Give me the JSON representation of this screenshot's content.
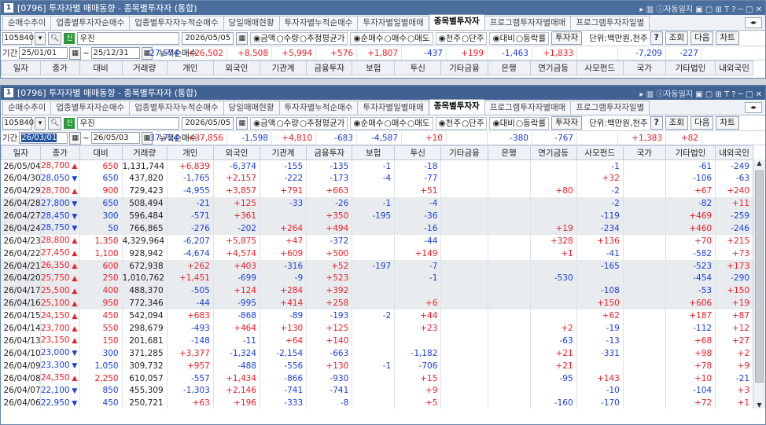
{
  "win1": {
    "title": "[0796] 투자자별 매매동향 - 종목별투자자 (통합)",
    "badge": "1",
    "tab_icons": "▸ ▥ ⓘ자동일지 ▣ ▢ ⊞ T ? ─ □ ✕",
    "tabs": [
      "순매수추이",
      "업종별투자자순매수",
      "업종별투자자누적순매수",
      "당일매매현황",
      "투자자별누적순매수",
      "투자자별일별매매",
      "종목별투자자",
      "프로그램투자자별매매",
      "프로그램투자자일별"
    ],
    "active_tab": 6,
    "code": "105840",
    "stock_badge": "신",
    "stock_name": "우진",
    "date": "2026/05/05",
    "opt_amount": "◉금액",
    "opt_qty": "○수량",
    "opt_avg": "○추정평균가",
    "opt_net": "◉순매수",
    "opt_buy": "○매수",
    "opt_sell": "○매도",
    "opt_k": "◉천주",
    "opt_dan": "○단주",
    "opt_vs": "◉대비",
    "opt_rate": "○등락률",
    "btn_investor": "투자자",
    "unit": "단위:백만원,천주",
    "btn_help": "?",
    "btn_search": "조회",
    "btn_next": "다음",
    "btn_chart": "차트",
    "period_label": "기간",
    "period_from": "25/01/01",
    "period_to": "25/12/31",
    "cum_label": "누적순매수",
    "cum_values": [
      "-27,574",
      "+26,502",
      "+8,508",
      "+5,994",
      "+576",
      "+1,807",
      "-437",
      "+199",
      "-1,463",
      "+1,833",
      "",
      "-7,209",
      "-227"
    ],
    "headers": [
      "일자",
      "종가",
      "대비",
      "거래량",
      "개인",
      "외국인",
      "기관계",
      "금융투자",
      "보험",
      "투신",
      "기타금융",
      "은행",
      "연기금등",
      "사모펀드",
      "국가",
      "기타법인",
      "내외국인"
    ]
  },
  "win2": {
    "title": "[0796] 투자자별 매매동향 - 종목별투자자 (통합)",
    "badge": "1",
    "tab_icons": "▸ ▥ ⓘ자동일지 ▣ ▢ ⊞ T ? ─ □ ✕",
    "tabs": [
      "순매수추이",
      "업종별투자자순매수",
      "업종별투자자누적순매수",
      "당일매매현황",
      "투자자별누적순매수",
      "투자자별일별매매",
      "종목별투자자",
      "프로그램투자자별매매",
      "프로그램투자자일별"
    ],
    "active_tab": 6,
    "code": "105840",
    "stock_badge": "신",
    "stock_name": "우진",
    "date": "2026/05/05",
    "opt_amount": "◉금액",
    "opt_qty": "○수량",
    "opt_avg": "○추정평균가",
    "opt_net": "◉순매수",
    "opt_buy": "○매수",
    "opt_sell": "○매도",
    "opt_k": "◉천주",
    "opt_dan": "○단주",
    "opt_vs": "◉대비",
    "opt_rate": "○등락률",
    "btn_investor": "투자자",
    "unit": "단위:백만원,천주",
    "btn_help": "?",
    "btn_search": "조회",
    "btn_next": "다음",
    "btn_chart": "차트",
    "period_label": "기간",
    "period_from": "26/03/01",
    "period_to": "26/05/03",
    "cum_label": "누적순매수",
    "cum_values": [
      "-37,724",
      "+37,856",
      "-1,598",
      "+4,810",
      "-683",
      "-4,587",
      "+10",
      "",
      "-380",
      "-767",
      "",
      "+1,383",
      "+82"
    ],
    "headers": [
      "일자",
      "종가",
      "대비",
      "거래량",
      "개인",
      "외국인",
      "기관계",
      "금융투자",
      "보험",
      "투신",
      "기타금융",
      "은행",
      "연기금등",
      "사모펀드",
      "국가",
      "기타법인",
      "내외국인"
    ],
    "rows": [
      [
        "26/05/04",
        "28,700",
        "▲",
        "650",
        "1,131,744",
        "+6,839",
        "-6,374",
        "-155",
        "-135",
        "-1",
        "-18",
        "",
        "",
        "",
        "-1",
        "",
        "-61",
        "-249"
      ],
      [
        "26/04/30",
        "28,050",
        "▼",
        "650",
        "437,820",
        "-1,765",
        "+2,157",
        "-222",
        "-173",
        "-4",
        "-77",
        "",
        "",
        "",
        "+32",
        "",
        "-106",
        "-63"
      ],
      [
        "26/04/29",
        "28,700",
        "▲",
        "900",
        "729,423",
        "-4,955",
        "+3,857",
        "+791",
        "+663",
        "",
        "+51",
        "",
        "",
        "+80",
        "-2",
        "",
        "+67",
        "+240"
      ],
      [
        "26/04/28",
        "27,800",
        "▼",
        "650",
        "508,494",
        "-21",
        "+125",
        "-33",
        "-26",
        "-1",
        "-4",
        "",
        "",
        "",
        "-2",
        "",
        "-82",
        "+11"
      ],
      [
        "26/04/27",
        "28,450",
        "▼",
        "300",
        "596,484",
        "-571",
        "+361",
        "",
        "+350",
        "-195",
        "-36",
        "",
        "",
        "",
        "-119",
        "",
        "+469",
        "-259"
      ],
      [
        "26/04/24",
        "28,750",
        "▼",
        "50",
        "766,865",
        "-276",
        "-202",
        "+264",
        "+494",
        "",
        "-16",
        "",
        "",
        "+19",
        "-234",
        "",
        "+460",
        "-246"
      ],
      [
        "26/04/23",
        "28,800",
        "▲",
        "1,350",
        "4,329,964",
        "-6,207",
        "+5,875",
        "+47",
        "-372",
        "",
        "-44",
        "",
        "",
        "+328",
        "+136",
        "",
        "+70",
        "+215"
      ],
      [
        "26/04/22",
        "27,450",
        "▲",
        "1,100",
        "928,942",
        "-4,674",
        "+4,574",
        "+609",
        "+500",
        "",
        "+149",
        "",
        "",
        "+1",
        "-41",
        "",
        "-582",
        "+73"
      ],
      [
        "26/04/21",
        "26,350",
        "▲",
        "600",
        "672,938",
        "+262",
        "+403",
        "-316",
        "+52",
        "-197",
        "-7",
        "",
        "",
        "",
        "-165",
        "",
        "-523",
        "+173"
      ],
      [
        "26/04/20",
        "25,750",
        "▲",
        "250",
        "1,010,762",
        "+1,451",
        "-699",
        "-9",
        "+523",
        "",
        "-1",
        "",
        "",
        "-530",
        "",
        "",
        "-454",
        "-290"
      ],
      [
        "26/04/17",
        "25,500",
        "▲",
        "400",
        "488,370",
        "-505",
        "+124",
        "+284",
        "+392",
        "",
        "",
        "",
        "",
        "",
        "-108",
        "",
        "-53",
        "+150"
      ],
      [
        "26/04/16",
        "25,100",
        "▲",
        "950",
        "772,346",
        "-44",
        "-995",
        "+414",
        "+258",
        "",
        "+6",
        "",
        "",
        "",
        "+150",
        "",
        "+606",
        "+19"
      ],
      [
        "26/04/15",
        "24,150",
        "▲",
        "450",
        "542,094",
        "+683",
        "-868",
        "-89",
        "-193",
        "-2",
        "+44",
        "",
        "",
        "",
        "+62",
        "",
        "+187",
        "+87"
      ],
      [
        "26/04/14",
        "23,700",
        "▲",
        "550",
        "298,679",
        "-493",
        "+464",
        "+130",
        "+125",
        "",
        "+23",
        "",
        "",
        "+2",
        "-19",
        "",
        "-112",
        "+12"
      ],
      [
        "26/04/13",
        "23,150",
        "▲",
        "150",
        "201,681",
        "-148",
        "-11",
        "+64",
        "+140",
        "",
        "",
        "",
        "",
        "-63",
        "-13",
        "",
        "+68",
        "+27"
      ],
      [
        "26/04/10",
        "23,000",
        "▼",
        "300",
        "371,285",
        "+3,377",
        "-1,324",
        "-2,154",
        "-663",
        "",
        "-1,182",
        "",
        "",
        "+21",
        "-331",
        "",
        "+98",
        "+2"
      ],
      [
        "26/04/09",
        "23,300",
        "▼",
        "1,050",
        "309,732",
        "+957",
        "-488",
        "-556",
        "+130",
        "-1",
        "-706",
        "",
        "",
        "+21",
        "",
        "",
        "+78",
        "+9"
      ],
      [
        "26/04/08",
        "24,350",
        "▲",
        "2,250",
        "610,057",
        "-557",
        "+1,434",
        "-866",
        "-930",
        "",
        "+15",
        "",
        "",
        "-95",
        "+143",
        "",
        "+10",
        "-21"
      ],
      [
        "26/04/07",
        "22,100",
        "▼",
        "850",
        "455,309",
        "-1,303",
        "+2,146",
        "-741",
        "-741",
        "",
        "+9",
        "",
        "",
        "",
        "-10",
        "",
        "-104",
        "+3"
      ],
      [
        "26/04/06",
        "22,950",
        "▼",
        "450",
        "250,721",
        "+63",
        "+196",
        "-333",
        "-8",
        "",
        "+5",
        "",
        "",
        "-160",
        "-170",
        "",
        "+72",
        "+1"
      ]
    ]
  },
  "colors": {
    "positive": "#e8202a",
    "negative": "#1a3fd6",
    "title_bar": "#4b6f9d",
    "row_shade": "#e9ecef"
  }
}
